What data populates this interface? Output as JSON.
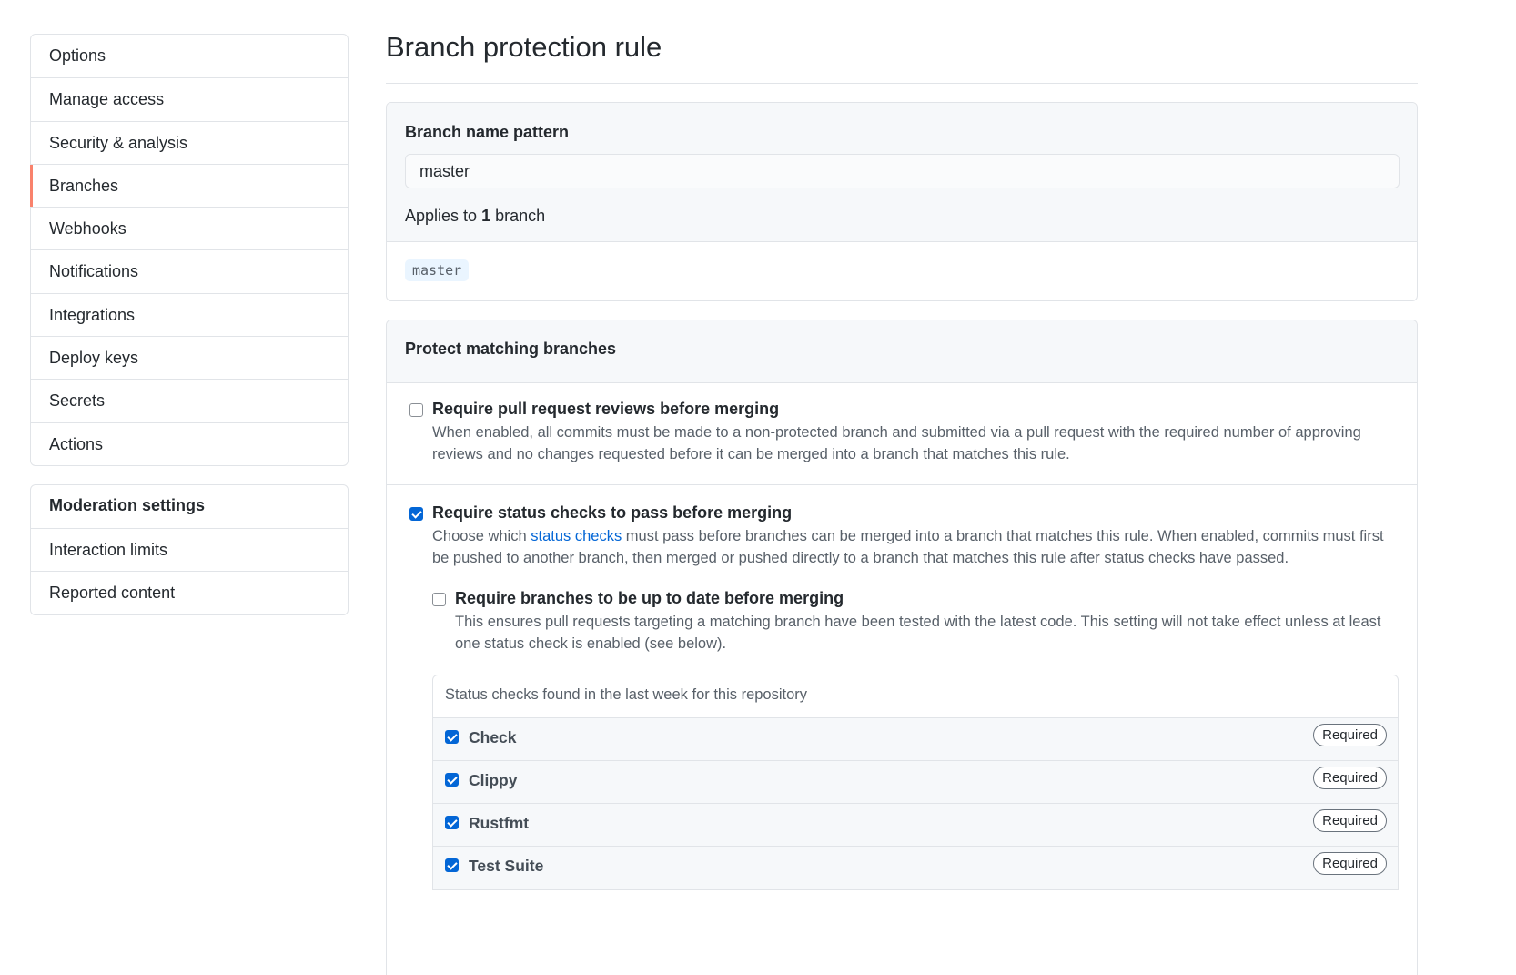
{
  "sidebar": {
    "items": [
      {
        "label": "Options"
      },
      {
        "label": "Manage access"
      },
      {
        "label": "Security & analysis"
      },
      {
        "label": "Branches"
      },
      {
        "label": "Webhooks"
      },
      {
        "label": "Notifications"
      },
      {
        "label": "Integrations"
      },
      {
        "label": "Deploy keys"
      },
      {
        "label": "Secrets"
      },
      {
        "label": "Actions"
      }
    ],
    "selected": "Branches",
    "accent_color": "#f9826c",
    "moderation": {
      "heading": "Moderation settings",
      "items": [
        {
          "label": "Interaction limits"
        },
        {
          "label": "Reported content"
        }
      ]
    }
  },
  "main": {
    "title": "Branch protection rule",
    "pattern": {
      "label": "Branch name pattern",
      "value": "master",
      "applies_prefix": "Applies to",
      "applies_count": "1",
      "applies_suffix": "branch",
      "matched_branch": "master"
    },
    "protect": {
      "heading": "Protect matching branches",
      "require_reviews": {
        "title": "Require pull request reviews before merging",
        "note": "When enabled, all commits must be made to a non-protected branch and submitted via a pull request with the required number of approving reviews and no changes requested before it can be merged into a branch that matches this rule.",
        "checked": false
      },
      "require_status": {
        "title": "Require status checks to pass before merging",
        "note_prefix": "Choose which",
        "note_link": "status checks",
        "note_suffix": "must pass before branches can be merged into a branch that matches this rule. When enabled, commits must first be pushed to another branch, then merged or pushed directly to a branch that matches this rule after status checks have passed.",
        "checked": true
      },
      "require_up_to_date": {
        "title": "Require branches to be up to date before merging",
        "note": "This ensures pull requests targeting a matching branch have been tested with the latest code. This setting will not take effect unless at least one status check is enabled (see below).",
        "checked": false
      },
      "status_checks": {
        "heading": "Status checks found in the last week for this repository",
        "required_label": "Required",
        "items": [
          {
            "name": "Check",
            "checked": true
          },
          {
            "name": "Clippy",
            "checked": true
          },
          {
            "name": "Rustfmt",
            "checked": true
          },
          {
            "name": "Test Suite",
            "checked": true
          }
        ]
      }
    }
  },
  "colors": {
    "link": "#0366d6",
    "checkbox_checked": "#0366d6",
    "border": "#e1e4e8",
    "header_bg": "#f6f8fa"
  }
}
